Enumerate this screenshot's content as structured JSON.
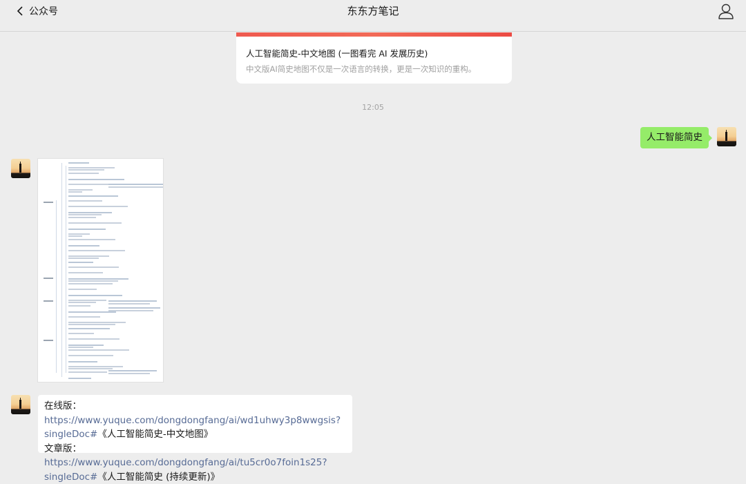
{
  "header": {
    "back_label": "公众号",
    "title": "东东方笔记"
  },
  "article": {
    "title": "人工智能简史-中文地图 (一图看完 AI 发展历史)",
    "desc": "中文版AI简史地图不仅是一次语言的转换，更是一次知识的重构。",
    "accent": "#ef5a4f"
  },
  "timestamp": "12:05",
  "outgoing": {
    "text": "人工智能简史",
    "color": "#95ec69"
  },
  "links_message": {
    "online_label": "在线版：",
    "online_url_1": "https://www.yuque.com/dongdongfang/ai/wd1uhwy3p8wwgsis?",
    "online_url_2": "singleDoc#",
    "online_title": "《人工智能简史-中文地图》",
    "article_label": "文章版：",
    "article_url_1": "https://www.yuque.com/dongdongfang/ai/tu5cr0o7foin1s25?",
    "article_url_2": "singleDoc#",
    "article_title": "《人工智能简史 (持续更新)》",
    "link_color": "#576b95"
  },
  "icons": {
    "back": "chevron-left-icon",
    "profile": "person-icon"
  }
}
